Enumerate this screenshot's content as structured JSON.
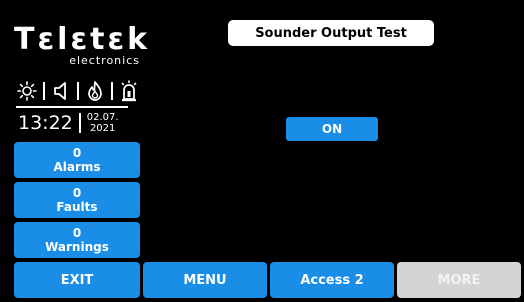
{
  "brand": {
    "name": "Tεlεtεk",
    "sub": "electronics"
  },
  "status_icons": [
    "sun-icon",
    "speaker-icon",
    "flame-icon",
    "siren-icon"
  ],
  "clock": {
    "time": "13:22",
    "date_day_month": "02.07.",
    "date_year": "2021"
  },
  "counters": {
    "alarms": {
      "count": "0",
      "label": "Alarms"
    },
    "faults": {
      "count": "0",
      "label": "Faults"
    },
    "warnings": {
      "count": "0",
      "label": "Warnings"
    }
  },
  "screen": {
    "title": "Sounder Output Test",
    "on_label": "ON"
  },
  "bottom_bar": {
    "exit": "EXIT",
    "menu": "MENU",
    "access": "Access 2",
    "more": "MORE"
  },
  "colors": {
    "accent": "#1a8ee6",
    "disabled": "#d4d4d4",
    "background": "#000000"
  }
}
